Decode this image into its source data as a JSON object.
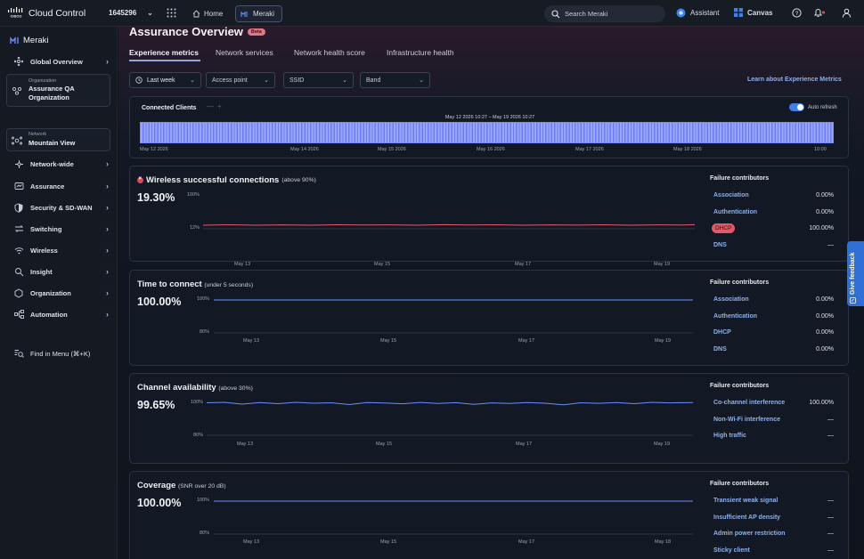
{
  "topbar": {
    "brand": "Cloud Control",
    "org_id": "1645296",
    "home": "Home",
    "meraki": "Meraki",
    "search_placeholder": "Search Meraki",
    "assistant": "Assistant",
    "canvas": "Canvas"
  },
  "sidebar": {
    "logo": "Meraki",
    "global": "Global Overview",
    "org": {
      "label": "Organization",
      "value": "Assurance QA Organization"
    },
    "network": {
      "label": "Network",
      "value": "Mountain View"
    },
    "items": [
      {
        "label": "Network-wide",
        "icon": "network-wide-icon"
      },
      {
        "label": "Assurance",
        "icon": "assurance-icon"
      },
      {
        "label": "Security & SD-WAN",
        "icon": "shield-icon"
      },
      {
        "label": "Switching",
        "icon": "switch-icon"
      },
      {
        "label": "Wireless",
        "icon": "wifi-icon"
      },
      {
        "label": "Insight",
        "icon": "insight-icon"
      },
      {
        "label": "Organization",
        "icon": "organization-icon"
      },
      {
        "label": "Automation",
        "icon": "automation-icon"
      }
    ],
    "find": "Find in Menu (⌘+K)"
  },
  "page": {
    "title": "Assurance Overview",
    "badge": "Beta",
    "tabs": [
      "Experience metrics",
      "Network services",
      "Network health score",
      "Infrastructure health"
    ],
    "filters": {
      "time": "Last week",
      "ap": "Access point",
      "ssid": "SSID",
      "band": "Band"
    },
    "learn": "Learn about Experience Metrics"
  },
  "timeline": {
    "title": "Connected Clients",
    "range": "May 12 2026 10:27 – May 19 2026 10:27",
    "auto_refresh": "Auto refresh",
    "ticks": [
      "May 12 2026",
      "May 14 2026",
      "May 15 2026",
      "May 16 2026",
      "May 17 2026",
      "May 18 2026",
      "10:00"
    ]
  },
  "cards": [
    {
      "title": "Wireless successful connections",
      "sub": "(above 90%)",
      "value": "19.30%",
      "ymax": "100%",
      "ymin": "12%",
      "x": [
        "May 13",
        "May 15",
        "May 17",
        "May 19"
      ],
      "fc_title": "Failure contributors",
      "contributors": [
        {
          "name": "Association",
          "value": "0.00%"
        },
        {
          "name": "Authentication",
          "value": "0.00%"
        },
        {
          "name": "DHCP",
          "value": "100.00%"
        },
        {
          "name": "DNS",
          "value": "—"
        }
      ]
    },
    {
      "title": "Time to connect",
      "sub": "(under 5 seconds)",
      "value": "100.00%",
      "ymax": "100%",
      "ymin": "80%",
      "x": [
        "May 13",
        "May 15",
        "May 17",
        "May 19"
      ],
      "fc_title": "Failure contributors",
      "contributors": [
        {
          "name": "Association",
          "value": "0.00%"
        },
        {
          "name": "Authentication",
          "value": "0.00%"
        },
        {
          "name": "DHCP",
          "value": "0.00%"
        },
        {
          "name": "DNS",
          "value": "0.00%"
        }
      ]
    },
    {
      "title": "Channel availability",
      "sub": "(above 30%)",
      "value": "99.65%",
      "ymax": "100%",
      "ymin": "80%",
      "x": [
        "May 13",
        "May 15",
        "May 17",
        "May 19"
      ],
      "fc_title": "Failure contributors",
      "contributors": [
        {
          "name": "Co-channel interference",
          "value": "100.00%"
        },
        {
          "name": "Non-Wi-Fi interference",
          "value": "—"
        },
        {
          "name": "High traffic",
          "value": "—"
        }
      ]
    },
    {
      "title": "Coverage",
      "sub": "(SNR over 20 dB)",
      "value": "100.00%",
      "ymax": "100%",
      "ymin": "80%",
      "x": [
        "May 13",
        "May 15",
        "May 17",
        "May 18"
      ],
      "fc_title": "Failure contributors",
      "contributors": [
        {
          "name": "Transient weak signal",
          "value": "—"
        },
        {
          "name": "Insufficient AP density",
          "value": "—"
        },
        {
          "name": "Admin power restriction",
          "value": "—"
        },
        {
          "name": "Sticky client",
          "value": "—"
        }
      ]
    }
  ],
  "feedback": "Give feedback",
  "colors": {
    "accent": "#6b8cff",
    "danger": "#e05a6a",
    "link": "#8fb0ea"
  }
}
